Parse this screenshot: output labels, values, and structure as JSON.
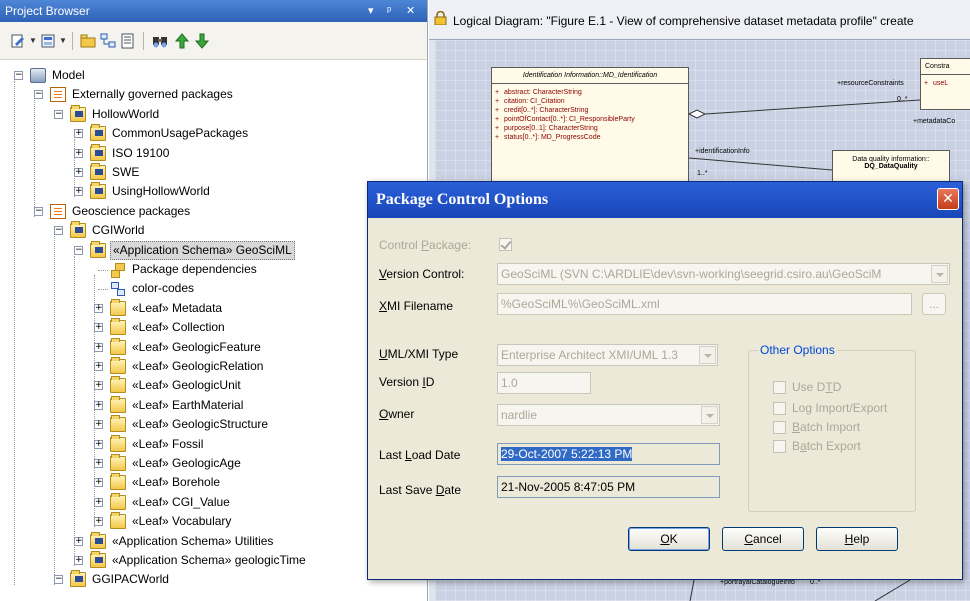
{
  "browser": {
    "title": "Project Browser",
    "pin_glyph": "▾",
    "autohide_glyph": "ᵩ",
    "close_glyph": "✕",
    "toolbar_icons": [
      "new-element-icon",
      "new-diagram-icon",
      "new-package-icon",
      "new-view-icon",
      "properties-icon",
      "find-icon",
      "move-up-icon",
      "move-down-icon"
    ]
  },
  "tree": [
    {
      "level": 0,
      "expander": "−",
      "icon": "model",
      "label": "Model"
    },
    {
      "level": 1,
      "expander": "−",
      "icon": "view",
      "label": "Externally governed packages"
    },
    {
      "level": 2,
      "expander": "−",
      "icon": "pkgds",
      "label": "HollowWorld"
    },
    {
      "level": 3,
      "expander": "+",
      "icon": "pkgds",
      "label": "CommonUsagePackages"
    },
    {
      "level": 3,
      "expander": "+",
      "icon": "pkgds",
      "label": "ISO 19100"
    },
    {
      "level": 3,
      "expander": "+",
      "icon": "pkgds",
      "label": "SWE"
    },
    {
      "level": 3,
      "expander": "+",
      "icon": "pkgds",
      "label": "UsingHollowWorld"
    },
    {
      "level": 1,
      "expander": "−",
      "icon": "view",
      "label": "Geoscience packages"
    },
    {
      "level": 2,
      "expander": "−",
      "icon": "pkgds",
      "label": "CGIWorld"
    },
    {
      "level": 3,
      "expander": "−",
      "icon": "pkgds",
      "label": "«Application Schema» GeoSciML",
      "selected": true
    },
    {
      "level": 4,
      "expander": "",
      "icon": "dep",
      "label": "Package dependencies"
    },
    {
      "level": 4,
      "expander": "",
      "icon": "cls",
      "label": "color-codes"
    },
    {
      "level": 4,
      "expander": "+",
      "icon": "pkg",
      "label": "«Leaf» Metadata"
    },
    {
      "level": 4,
      "expander": "+",
      "icon": "pkg",
      "label": "«Leaf» Collection"
    },
    {
      "level": 4,
      "expander": "+",
      "icon": "pkg",
      "label": "«Leaf» GeologicFeature"
    },
    {
      "level": 4,
      "expander": "+",
      "icon": "pkg",
      "label": "«Leaf» GeologicRelation"
    },
    {
      "level": 4,
      "expander": "+",
      "icon": "pkg",
      "label": "«Leaf» GeologicUnit"
    },
    {
      "level": 4,
      "expander": "+",
      "icon": "pkg",
      "label": "«Leaf» EarthMaterial"
    },
    {
      "level": 4,
      "expander": "+",
      "icon": "pkg",
      "label": "«Leaf» GeologicStructure"
    },
    {
      "level": 4,
      "expander": "+",
      "icon": "pkg",
      "label": "«Leaf» Fossil"
    },
    {
      "level": 4,
      "expander": "+",
      "icon": "pkg",
      "label": "«Leaf» GeologicAge"
    },
    {
      "level": 4,
      "expander": "+",
      "icon": "pkg",
      "label": "«Leaf» Borehole"
    },
    {
      "level": 4,
      "expander": "+",
      "icon": "pkg",
      "label": "«Leaf» CGI_Value"
    },
    {
      "level": 4,
      "expander": "+",
      "icon": "pkg",
      "label": "«Leaf» Vocabulary"
    },
    {
      "level": 3,
      "expander": "+",
      "icon": "pkgds",
      "label": "«Application Schema» Utilities"
    },
    {
      "level": 3,
      "expander": "+",
      "icon": "pkgds",
      "label": "«Application Schema» geologicTime"
    },
    {
      "level": 2,
      "expander": "−",
      "icon": "pkgds",
      "label": "GGIPACWorld"
    }
  ],
  "diagram": {
    "tab_title": "Logical Diagram: \"Figure E.1 - View of comprehensive dataset metadata profile\"  create",
    "class_header": "Identification Information::MD_Identification",
    "attributes": [
      "abstract: CharacterString",
      "citation: CI_Citation",
      "credit[0..*]: CharacterString",
      "pointOfContact[0..*]: CI_ResponsibleParty",
      "purpose[0..1]: CharacterString",
      "status[0..*]: MD_ProgressCode"
    ],
    "right_class_header": "Constra",
    "right_class_attr": "useL",
    "dq_class_header": "Data quality information::",
    "dq_class_name": "DQ_DataQuality",
    "labels": {
      "resource_constraints": "+resourceConstraints",
      "mult_zero_many": "0..*",
      "metadata_co": "+metadataCo",
      "identification_info": "+identificationInfo",
      "mult_one_many": "1..*",
      "portrayal": "+portrayalCatalogueInfo",
      "mult_zero_many_2": "0..*"
    }
  },
  "dialog": {
    "title": "Package Control Options",
    "close_glyph": "✕",
    "labels": {
      "control_package_pre": "Control ",
      "control_package_key": "P",
      "control_package_post": "ackage:",
      "version_control_key": "V",
      "version_control_post": "ersion Control:",
      "xmi_filename_key": "X",
      "xmi_filename_post": "MI Filename",
      "uml_type_key": "U",
      "uml_type_post": "ML/XMI Type",
      "version_id_pre": "Version ",
      "version_id_key": "I",
      "version_id_post": "D",
      "owner_key": "O",
      "owner_post": "wner",
      "last_load_pre": "Last ",
      "last_load_key": "L",
      "last_load_post": "oad Date",
      "last_save_pre": "Last Save ",
      "last_save_key": "D",
      "last_save_post": "ate"
    },
    "values": {
      "control_package_checked": true,
      "version_control": "GeoSciML (SVN C:\\ARDLIE\\dev\\svn-working\\seegrid.csiro.au\\GeoSciM",
      "xmi_filename": "%GeoSciML%\\GeoSciML.xml",
      "browse": "...",
      "uml_type": "Enterprise Architect XMI/UML 1.3",
      "version_id": "1.0",
      "owner": "nardlie",
      "last_load": "29-Oct-2007 5:22:13 PM",
      "last_save": "21-Nov-2005 8:47:05 PM"
    },
    "other_options": {
      "title": "Other Options",
      "use_dtd_pre": "Use D",
      "use_dtd_key": "T",
      "use_dtd_post": "D",
      "log_import": "Log Import/Export",
      "batch_import_key": "B",
      "batch_import_post": "atch Import",
      "batch_export_pre": "B",
      "batch_export_key": "a",
      "batch_export_post": "tch Export"
    },
    "buttons": {
      "ok_key": "O",
      "ok_post": "K",
      "cancel_key": "C",
      "cancel_post": "ancel",
      "help_key": "H",
      "help_post": "elp"
    }
  }
}
